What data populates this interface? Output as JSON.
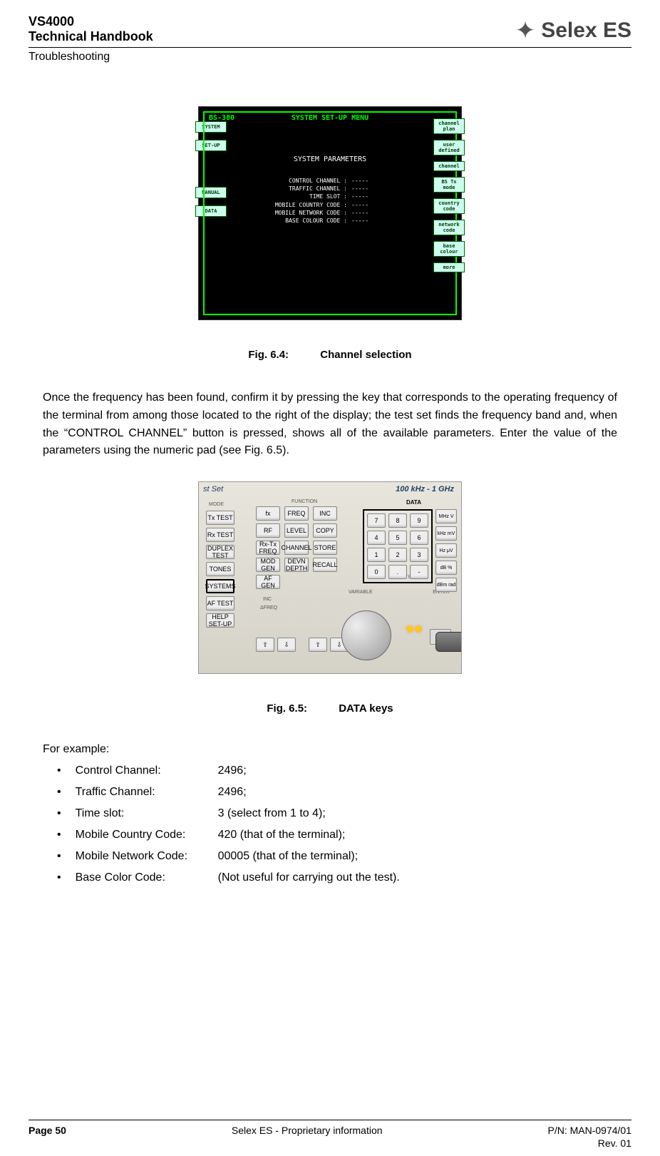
{
  "header": {
    "line1": "VS4000",
    "line2": "Technical Handbook",
    "sub": "Troubleshooting",
    "logo_text": "Selex ES"
  },
  "fig64": {
    "caption_num": "Fig. 6.4:",
    "caption_text": "Channel selection",
    "bs": "BS-380",
    "title": "SYSTEM SET-UP MENU",
    "subtitle": "SYSTEM PARAMETERS",
    "params": [
      {
        "k": "CONTROL CHANNEL :",
        "v": "-----"
      },
      {
        "k": "TRAFFIC CHANNEL :",
        "v": "-----"
      },
      {
        "k": "TIME SLOT :",
        "v": "-----"
      },
      {
        "k": "MOBILE COUNTRY CODE :",
        "v": "-----"
      },
      {
        "k": "MOBILE NETWORK CODE :",
        "v": "-----"
      },
      {
        "k": "BASE COLOUR CODE :",
        "v": "-----"
      }
    ],
    "left_buttons": [
      "SYSTEM",
      "SET-UP",
      "",
      "MANUAL",
      "DATA"
    ],
    "right_buttons": [
      "channel plan",
      "user defined",
      "channel",
      "BS Tx mode",
      "country code",
      "network code",
      "base colour",
      "more"
    ]
  },
  "paragraph": "Once the frequency has been found, confirm it by pressing the key that corresponds to the operating frequency of the terminal from among those located to the right of the display; the test set finds the frequency band and, when the “CONTROL CHANNEL” button is pressed, shows all of the available parameters.  Enter the value of the parameters using the numeric pad (see Fig. 6.5).",
  "fig65": {
    "caption_num": "Fig. 6.5:",
    "caption_text": "DATA keys",
    "brand": "st Set",
    "range": "100 kHz - 1 GHz",
    "data_label": "DATA",
    "mode_buttons": [
      "Tx TEST",
      "Rx TEST",
      "DUPLEX TEST",
      "TONES",
      "SYSTEMS",
      "AF TEST",
      "HELP SET-UP"
    ],
    "func_cols": [
      [
        "fx",
        "RF",
        "Rx-Tx FREQ",
        "MOD GEN",
        "AF GEN"
      ],
      [
        "FREQ",
        "LEVEL",
        "CHANNEL",
        "DEVN DEPTH",
        ""
      ],
      [
        "INC",
        "COPY",
        "STORE",
        "RECALL",
        ""
      ]
    ],
    "keypad": [
      [
        "7",
        "8",
        "9"
      ],
      [
        "4",
        "5",
        "6"
      ],
      [
        "1",
        "2",
        "3"
      ],
      [
        "0",
        ".",
        "-"
      ]
    ],
    "side_buttons": [
      "MHz V",
      "kHz mV",
      "Hz μV",
      "dB %",
      "dBm rad"
    ],
    "labels": {
      "mode": "MODE",
      "function": "FUNCTION",
      "inc": "INC",
      "freq": "ΔFREQ",
      "variable": "VARIABLE",
      "enter": "ENTER",
      "delete": "DELETE"
    }
  },
  "example": {
    "intro": "For example:",
    "items": [
      {
        "k": "Control Channel:",
        "v": "2496;"
      },
      {
        "k": "Traffic Channel:",
        "v": "2496;"
      },
      {
        "k": "Time slot:",
        "v": "3 (select from 1 to 4);"
      },
      {
        "k": "Mobile Country Code:",
        "v": "420 (that of the terminal);"
      },
      {
        "k": "Mobile Network Code:",
        "v": "00005 (that of the terminal);"
      },
      {
        "k": "Base Color Code:",
        "v": "(Not useful for carrying out the test)."
      }
    ]
  },
  "footer": {
    "left": "Page 50",
    "center": "Selex ES - Proprietary information",
    "right1": "P/N: MAN-0974/01",
    "right2": "Rev. 01"
  }
}
